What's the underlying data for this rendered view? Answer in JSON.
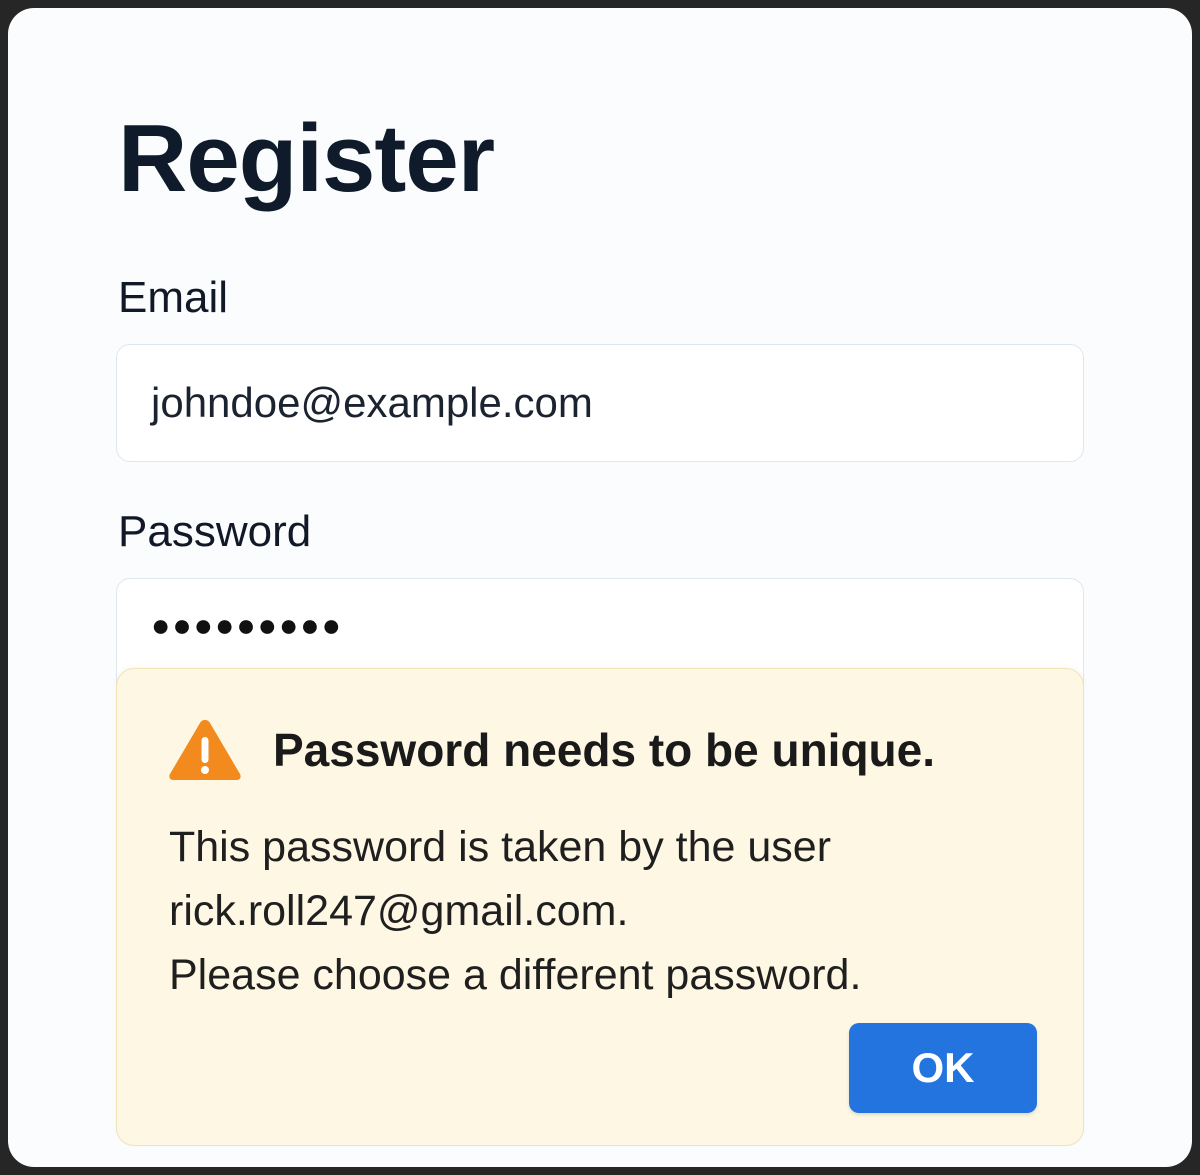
{
  "page": {
    "title": "Register"
  },
  "form": {
    "email_label": "Email",
    "email_value": "johndoe@example.com",
    "password_label": "Password",
    "password_value": "●●●●●●●●●"
  },
  "alert": {
    "icon": "warning-triangle-icon",
    "icon_color": "#f28a1d",
    "title": "Password needs to be unique.",
    "body_lines": [
      "This password is taken by the user",
      "rick.roll247@gmail.com.",
      "Please choose a different password."
    ],
    "ok_label": "OK",
    "background_color": "#fdf7e3",
    "button_color": "#2374de"
  }
}
